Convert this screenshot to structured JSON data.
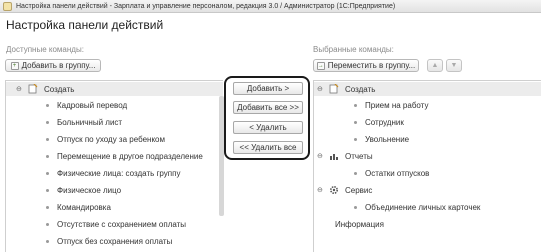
{
  "window": {
    "title": "Настройка панели действий - Зарплата и управление персоналом, редакция 3.0 / Администратор  (1С:Предприятие)"
  },
  "page_title": "Настройка панели действий",
  "left": {
    "label": "Доступные команды:",
    "add_to_group": "Добавить в группу...",
    "group_label": "Создать",
    "items": [
      "Кадровый перевод",
      "Больничный лист",
      "Отпуск по уходу за ребенком",
      "Перемещение в другое подразделение",
      "Физические лица: создать группу",
      "Физическое лицо",
      "Командировка",
      "Отсутствие с сохранением оплаты",
      "Отпуск без сохранения оплаты"
    ]
  },
  "middle": {
    "add": "Добавить >",
    "add_all": "Добавить все >>",
    "remove": "< Удалить",
    "remove_all": "<< Удалить все"
  },
  "right": {
    "label": "Выбранные команды:",
    "move_to_group": "Переместить в группу...",
    "groups": [
      {
        "label": "Создать",
        "items": [
          "Прием на работу",
          "Сотрудник",
          "Увольнение"
        ]
      },
      {
        "label": "Отчеты",
        "items": [
          "Остатки отпусков"
        ]
      },
      {
        "label": "Сервис",
        "items": [
          "Объединение личных карточек"
        ]
      }
    ],
    "standalone": "Информация"
  },
  "icons": {
    "expand": "⊖",
    "up": "▲",
    "down": "▼"
  }
}
